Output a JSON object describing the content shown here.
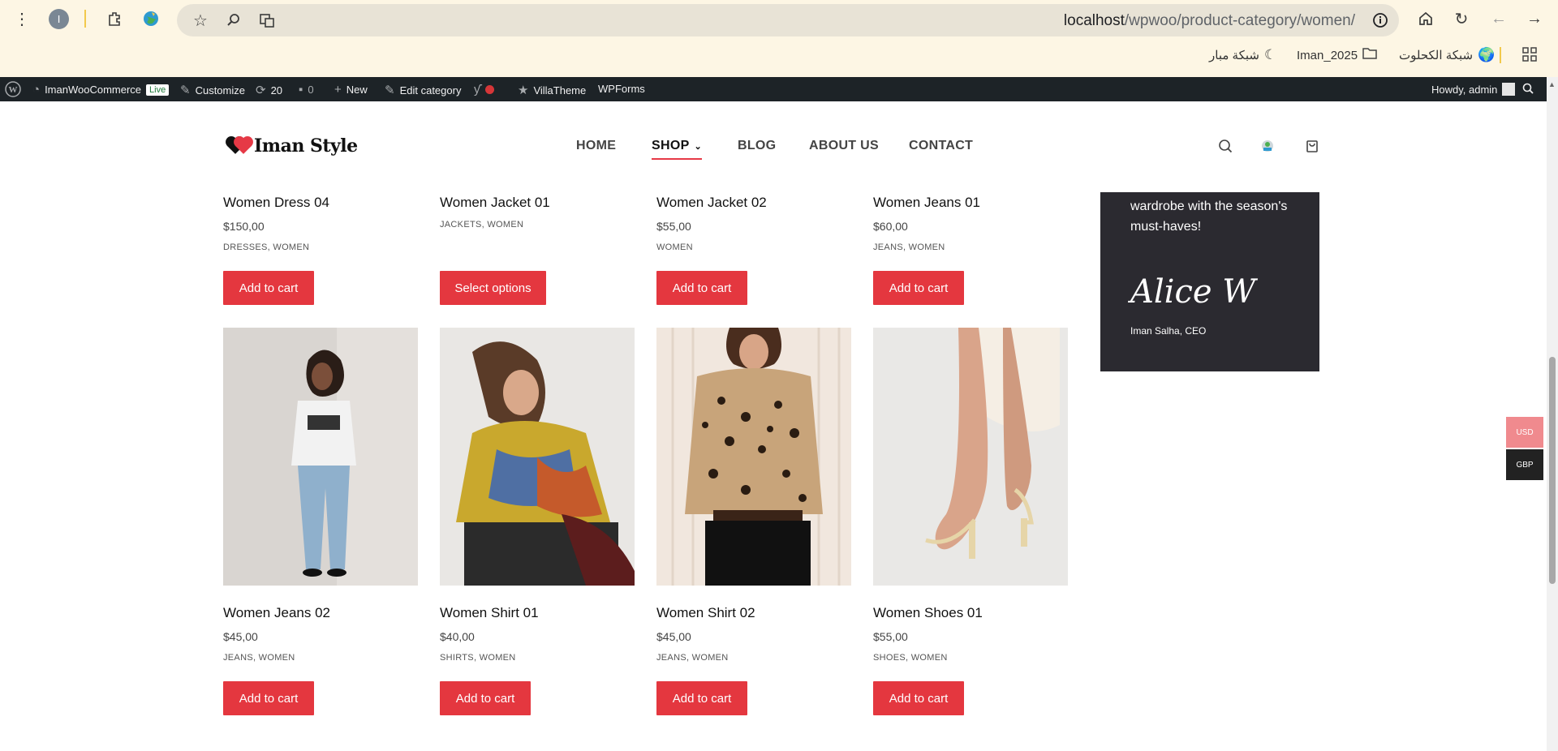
{
  "browser": {
    "profile_initial": "I",
    "url_host": "localhost",
    "url_path": "/wpwoo/product-category/women/",
    "bookmarks": [
      "شبكة مبار",
      "Iman_2025",
      "شبكة الكحلوت"
    ]
  },
  "admin_bar": {
    "site_name": "ImanWooCommerce",
    "live_badge": "Live",
    "customize": "Customize",
    "updates_count": "20",
    "comments_count": "0",
    "new": "New",
    "edit_category": "Edit category",
    "villatheme": "VillaTheme",
    "wpforms": "WPForms",
    "howdy": "Howdy, admin"
  },
  "header": {
    "brand": "Iman Style",
    "nav": [
      "HOME",
      "SHOP",
      "BLOG",
      "ABOUT US",
      "CONTACT"
    ]
  },
  "products_row1": [
    {
      "name": "Women Dress 04",
      "price": "$150,00",
      "cats": "DRESSES, WOMEN",
      "button": "Add to cart"
    },
    {
      "name": "Women Jacket 01",
      "price": "",
      "cats": "JACKETS, WOMEN",
      "button": "Select options"
    },
    {
      "name": "Women Jacket 02",
      "price": "$55,00",
      "cats": "WOMEN",
      "button": "Add to cart"
    },
    {
      "name": "Women Jeans 01",
      "price": "$60,00",
      "cats": "JEANS, WOMEN",
      "button": "Add to cart"
    }
  ],
  "products_row2": [
    {
      "name": "Women Jeans 02",
      "price": "$45,00",
      "cats": "JEANS, WOMEN",
      "button": "Add to cart"
    },
    {
      "name": "Women Shirt 01",
      "price": "$40,00",
      "cats": "SHIRTS, WOMEN",
      "button": "Add to cart"
    },
    {
      "name": "Women Shirt 02",
      "price": "$45,00",
      "cats": "JEANS, WOMEN",
      "button": "Add to cart"
    },
    {
      "name": "Women Shoes 01",
      "price": "$55,00",
      "cats": "SHOES, WOMEN",
      "button": "Add to cart"
    }
  ],
  "sidebar_card": {
    "text": "wardrobe with the season's must-haves!",
    "signature": "Alice W",
    "role": "Iman Salha, CEO"
  },
  "currency": {
    "usd": "USD",
    "gbp": "GBP"
  },
  "colors": {
    "accent": "#e4373f",
    "card_bg": "#2b2a30",
    "admin_bar": "#1d2327"
  }
}
